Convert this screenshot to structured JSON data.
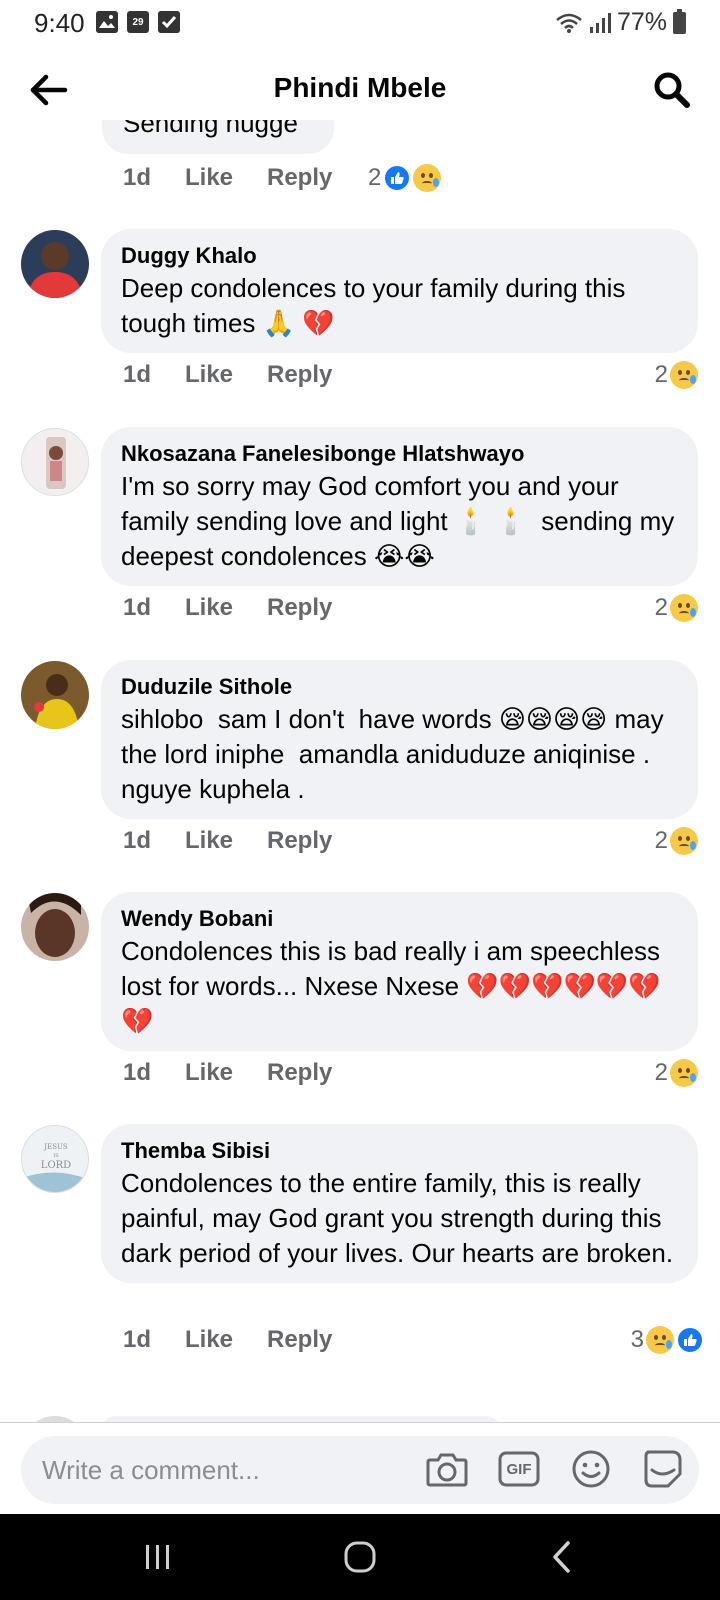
{
  "status_bar": {
    "time": "9:40",
    "calendar_day": "29",
    "battery": "77%",
    "icons": [
      "gallery-icon",
      "calendar-icon",
      "checkbox-icon",
      "wifi-icon",
      "signal-icon",
      "battery-icon"
    ]
  },
  "header": {
    "title": "Phindi Mbele",
    "back_icon": "back-arrow-icon",
    "search_icon": "search-icon"
  },
  "partial_comment": {
    "text": "Sending hugge",
    "time": "1d",
    "like": "Like",
    "reply": "Reply",
    "reaction_count": "2",
    "reactions": [
      "like",
      "sad"
    ]
  },
  "comments": [
    {
      "author": "Duggy Khalo",
      "text": "Deep condolences to your family during this tough times 🙏 💔",
      "time": "1d",
      "like": "Like",
      "reply": "Reply",
      "reaction_count": "2",
      "reactions": [
        "sad"
      ]
    },
    {
      "author": "Nkosazana Fanelesibonge Hlatshwayo",
      "text": "I'm so sorry may God comfort you and your family sending love and light 🕯️ 🕯️  sending my deepest condolences 😭😭",
      "time": "1d",
      "like": "Like",
      "reply": "Reply",
      "reaction_count": "2",
      "reactions": [
        "sad"
      ]
    },
    {
      "author": "Duduzile Sithole",
      "text": "sihlobo  sam I don't  have words 😪😪😪😪 may the lord iniphe  amandla aniduduze aniqinise . nguye kuphela .",
      "time": "1d",
      "like": "Like",
      "reply": "Reply",
      "reaction_count": "2",
      "reactions": [
        "sad"
      ]
    },
    {
      "author": "Wendy Bobani",
      "text": "Condolences this is bad really i am speechless  lost for words... Nxese Nxese 💔💔💔💔💔💔💔",
      "time": "1d",
      "like": "Like",
      "reply": "Reply",
      "reaction_count": "2",
      "reactions": [
        "sad"
      ]
    },
    {
      "author": "Themba Sibisi",
      "text": "Condolences to the entire family, this is really painful, may God grant you strength during this dark period of your lives. Our hearts are broken.",
      "time": "1d",
      "like": "Like",
      "reply": "Reply",
      "reaction_count": "3",
      "reactions": [
        "sad",
        "like"
      ]
    }
  ],
  "avatar_texts": {
    "themba": [
      "JESUS",
      "IS",
      "LORD"
    ]
  },
  "composer": {
    "placeholder": "Write a comment...",
    "icons": [
      "camera-icon",
      "gif-icon",
      "emoji-icon",
      "sticker-icon"
    ],
    "gif_label": "GIF"
  },
  "nav_bar": {
    "icons": [
      "recents-icon",
      "home-icon",
      "back-icon"
    ]
  },
  "colors": {
    "bubble": "#f0f2f5",
    "meta_text": "#65676b",
    "like_blue": "#1877f2",
    "sad_yellow": "#f7c948"
  }
}
